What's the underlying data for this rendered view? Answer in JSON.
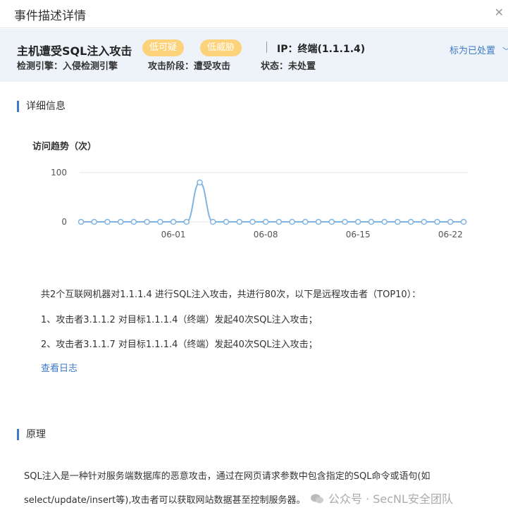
{
  "window": {
    "title": "事件描述详情"
  },
  "summary": {
    "headline": "主机遭受SQL注入攻击",
    "tags": [
      "低可疑",
      "低威胁"
    ],
    "ip": "IP：终端(1.1.1.4)",
    "action": "标为已处置",
    "meta": {
      "engine": "检测引擎：入侵检测引擎",
      "phase": "攻击阶段：遭受攻击",
      "status": "状态：未处置"
    }
  },
  "details": {
    "section_title": "详细信息",
    "chart_title": "访问趋势（次）",
    "intro": "共2个互联网机器对1.1.1.4 进行SQL注入攻击，共进行80次，以下是远程攻击者（TOP10）：",
    "attackers": [
      "1、攻击者3.1.1.2 对目标1.1.1.4（终端）发起40次SQL注入攻击；",
      "2、攻击者3.1.1.7 对目标1.1.1.4（终端）发起40次SQL注入攻击；"
    ],
    "view_log": "查看日志"
  },
  "principle": {
    "section_title": "原理",
    "line1": "SQL注入是一种针对服务端数据库的恶意攻击，通过在网页请求参数中包含指定的SQL命令或语句(如",
    "line2": "select/update/insert等),攻击者可以获取网站数据甚至控制服务器。"
  },
  "watermark": {
    "text": "公众号 · SecNL安全团队"
  },
  "chart_data": {
    "type": "line",
    "title": "访问趋势（次）",
    "xlabel": "",
    "ylabel": "",
    "x": [
      "05-25",
      "05-26",
      "05-27",
      "05-28",
      "05-29",
      "05-30",
      "05-31",
      "06-01",
      "06-02",
      "06-03",
      "06-04",
      "06-05",
      "06-06",
      "06-07",
      "06-08",
      "06-09",
      "06-10",
      "06-11",
      "06-12",
      "06-13",
      "06-14",
      "06-15",
      "06-16",
      "06-17",
      "06-18",
      "06-19",
      "06-20",
      "06-21",
      "06-22",
      "06-23"
    ],
    "series": [
      {
        "values": [
          0,
          0,
          0,
          0,
          0,
          0,
          0,
          0,
          0,
          80,
          0,
          0,
          0,
          0,
          0,
          0,
          0,
          0,
          0,
          0,
          0,
          0,
          0,
          0,
          0,
          0,
          0,
          0,
          0,
          0
        ]
      }
    ],
    "xticks": [
      "06-01",
      "06-08",
      "06-15",
      "06-22"
    ],
    "yticks": [
      0,
      100
    ],
    "ylim": [
      0,
      100
    ],
    "grid": true,
    "color": "#7fb3e3"
  }
}
